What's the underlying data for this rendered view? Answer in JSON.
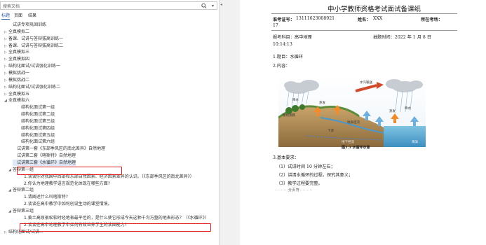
{
  "search": {
    "placeholder": "搜索文档",
    "icon": "search-icon",
    "dropdown": "▾"
  },
  "tabs": [
    {
      "label": "标题",
      "active": true
    },
    {
      "label": "页面",
      "active": false
    },
    {
      "label": "结果",
      "active": false
    }
  ],
  "outline": [
    {
      "label": "试讲专项巩固训练",
      "tri": ""
    },
    {
      "label": "全真模拟二",
      "tri": "▷"
    },
    {
      "label": "备课、试讲与答辩拔高训练一",
      "tri": "▷"
    },
    {
      "label": "备课、试讲与答辩拔高训练二",
      "tri": "▷"
    },
    {
      "label": "全真模拟三",
      "tri": "▷"
    },
    {
      "label": "全真模拟四",
      "tri": "▷"
    },
    {
      "label": "结构化面试/试讲强化训练一",
      "tri": "▷"
    },
    {
      "label": "模拟挑战一",
      "tri": "▷"
    },
    {
      "label": "模拟挑战二",
      "tri": "▷"
    },
    {
      "label": "结构化面试/试讲强化训练二",
      "tri": "▷"
    },
    {
      "label": "全真模拟五",
      "tri": "▷"
    },
    {
      "label": "全真模拟六",
      "tri": "◢"
    },
    {
      "label": "结构化面试第一组",
      "tri": ""
    },
    {
      "label": "结构化面试第二组",
      "tri": ""
    },
    {
      "label": "结构化面试第三组",
      "tri": ""
    },
    {
      "label": "结构化面试第四组",
      "tri": ""
    },
    {
      "label": "结构化面试第五组",
      "tri": ""
    },
    {
      "label": "结构化面试第六组",
      "tri": ""
    },
    {
      "label": "试讲第一套《东部季风区的南北差异》自然地理",
      "tri": ""
    },
    {
      "label": "试讲第二套《喀斯特》自然地理",
      "tri": ""
    },
    {
      "label": "试讲第三套《水循环》自然地理",
      "tri": ""
    },
    {
      "label": "答辩第一组",
      "tri": "◢"
    },
    {
      "label": "1.谈谈你对我国中西部和东部自然因素、经济因素差异的认识。（《东部季风区的南北差异》）",
      "tri": ""
    },
    {
      "label": "2.你认为地理教学语言规范化体现在哪些方面?",
      "tri": ""
    },
    {
      "label": "答辩第二组",
      "tri": "◢"
    },
    {
      "label": "1.请阐述什么叫喀斯特?",
      "tri": ""
    },
    {
      "label": "2.谈谈在高中教学中如何创设生动的课堂情境。",
      "tri": ""
    },
    {
      "label": "答辩第三组",
      "tri": "◢"
    },
    {
      "label": "1.黄土高原很松软时经地表最平坦的，是什么使它形成今天这种千沟万壑的地表形态？（《水循环》）",
      "tri": ""
    },
    {
      "label": "2.谈谈在高中地理教学中如何有效培养学生的读图能力?",
      "tri": ""
    },
    {
      "label": "结构化面试/试讲...",
      "tri": "▷"
    }
  ],
  "document": {
    "title": "中小学教师资格考试面试备课纸",
    "line1_label": "准考证号：",
    "line1_value": "13111623008921",
    "line1_name_label": "姓名：",
    "line1_name_value": "XXX",
    "line1_site_label": "所在考场：",
    "line1_cont": "17",
    "line2": "报考科目：高中地理",
    "line2_time_label": "抽题时间：2022 年 1 月 8 日",
    "line3": "10:14:13",
    "q1": "1.题目：水循环",
    "q2": "2.内容：",
    "fig_caption": "图3.3  水循环示意",
    "fig_labels": [
      "水汽输送",
      "降水",
      "降水",
      "蒸发",
      "植物蒸腾",
      "地表径流",
      "下渗",
      "地下径流",
      "海洋",
      "蒸发"
    ],
    "q3": "3.基本要求：",
    "r1": "（1）试讲时间 10 分钟左右；",
    "r2": "（2）讲清水循环的过程，探究其意义；",
    "r3": "（3）教学过程要完整。",
    "seal": "分页符"
  },
  "colors": {
    "highlight": "#e02020",
    "selected": "#dfe9f7",
    "tab_active": "#2b5aa6"
  }
}
